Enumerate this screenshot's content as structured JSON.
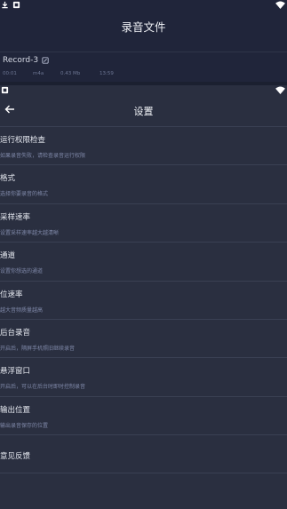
{
  "background_screen": {
    "title": "录音文件",
    "record": {
      "name": "Record-3",
      "duration": "00:01",
      "format": "m4a",
      "size": "0.43 Mb",
      "time": "13:59"
    }
  },
  "settings": {
    "title": "设置",
    "items": [
      {
        "title": "运行权限检查",
        "subtitle": "如果录音失败，请检查录音运行权限"
      },
      {
        "title": "格式",
        "subtitle": "选择你要录音的格式"
      },
      {
        "title": "采样速率",
        "subtitle": "设置采样速率越大越清晰"
      },
      {
        "title": "通道",
        "subtitle": "设置你想选的通道"
      },
      {
        "title": "位速率",
        "subtitle": "越大音频质量越高"
      },
      {
        "title": "后台录音",
        "subtitle": "开启后，隔屏手机照旧继续录音"
      },
      {
        "title": "悬浮窗口",
        "subtitle": "开启后，可以在后台时即时控制录音"
      },
      {
        "title": "输出位置",
        "subtitle": "输出录音保存的位置"
      }
    ],
    "feedback": "意见反馈"
  },
  "colors": {
    "background": "#262b3b",
    "sheet": "#2a2f40",
    "text": "#e7eaf1",
    "subtext": "#7f88a8",
    "divider": "#3a4053"
  }
}
